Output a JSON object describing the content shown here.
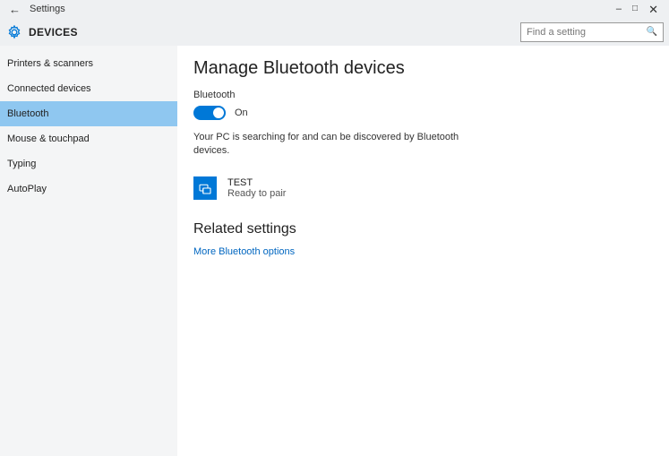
{
  "window": {
    "title": "Settings"
  },
  "header": {
    "category": "DEVICES",
    "search_placeholder": "Find a setting"
  },
  "sidebar": {
    "items": [
      {
        "label": "Printers & scanners",
        "active": false
      },
      {
        "label": "Connected devices",
        "active": false
      },
      {
        "label": "Bluetooth",
        "active": true
      },
      {
        "label": "Mouse & touchpad",
        "active": false
      },
      {
        "label": "Typing",
        "active": false
      },
      {
        "label": "AutoPlay",
        "active": false
      }
    ]
  },
  "main": {
    "page_title": "Manage Bluetooth devices",
    "toggle_label": "Bluetooth",
    "toggle_state_label": "On",
    "status_text": "Your PC is searching for and can be discovered by Bluetooth devices.",
    "device": {
      "name": "TEST",
      "status": "Ready to pair"
    },
    "related_title": "Related settings",
    "related_link": "More Bluetooth options"
  }
}
